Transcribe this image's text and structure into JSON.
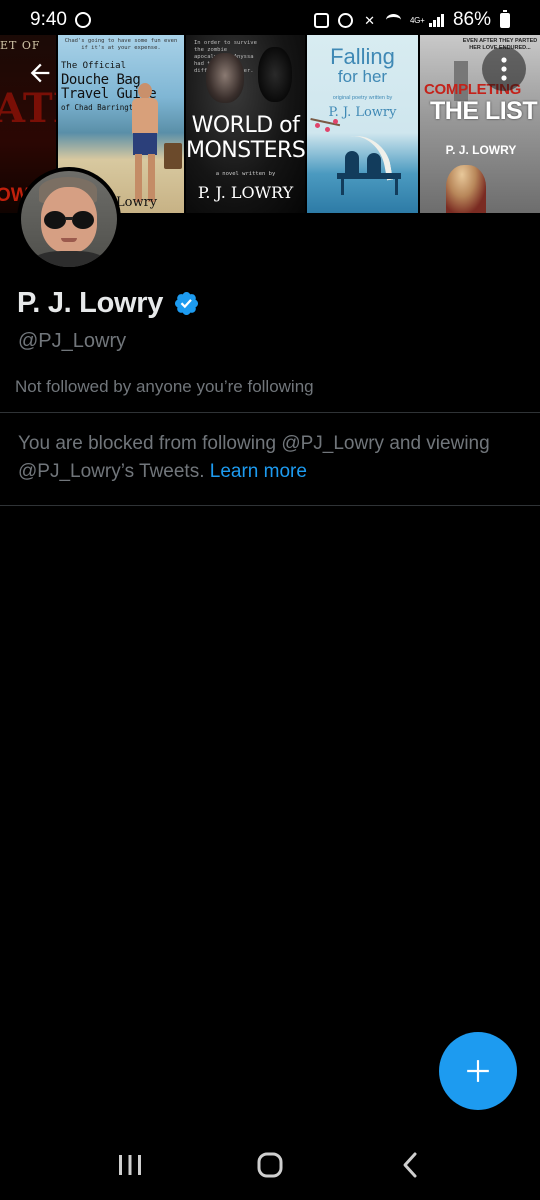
{
  "status_bar": {
    "time": "9:40",
    "network": "4G+",
    "battery": "86%"
  },
  "banner": {
    "book1": {
      "top": "ET OF",
      "middle": "ATH",
      "bottom": "OW"
    },
    "book2": {
      "tagline": "Chad's going to have some fun even if it's at your expense.",
      "line1": "The Official",
      "line2": "Douche Bag",
      "line3": "Travel Guide",
      "line4": "of Chad Barrington",
      "author": "Lowry"
    },
    "book3": {
      "tagline": "In order to survive the zombie apocalypse, Anyssa had to trust a different monster.",
      "title_line1": "WORLD of",
      "title_line2": "MONSTERS",
      "novel": "a novel written by",
      "author": "P. J. LOWRY"
    },
    "book4": {
      "title_line1": "Falling",
      "title_line2": "for her",
      "subtitle": "original poetry written by",
      "author": "P. J. Lowry"
    },
    "book5": {
      "tagline": "EVEN AFTER THEY PARTED HER LOVE ENDURED...",
      "title_line1": "COMPLETING",
      "title_line2": "THE LIST",
      "author": "P. J. LOWRY"
    }
  },
  "profile": {
    "name": "P. J. Lowry",
    "handle": "@PJ_Lowry",
    "followed_by": "Not followed by anyone you’re following",
    "verified": true
  },
  "blocked": {
    "message": "You are blocked from following @PJ_Lowry and viewing @PJ_Lowry’s Tweets.",
    "link": "Learn more"
  },
  "icons": {
    "back": "arrow-left-icon",
    "more": "more-vertical-icon",
    "verified": "verified-badge-icon",
    "compose": "plus-icon",
    "recent_apps": "recent-apps-icon",
    "home": "home-icon",
    "nav_back": "chevron-left-icon"
  },
  "colors": {
    "background": "#000000",
    "accent": "#1d9bf0",
    "text_primary": "#e7e9ea",
    "text_secondary": "#71767b",
    "divider": "#2f3336"
  }
}
